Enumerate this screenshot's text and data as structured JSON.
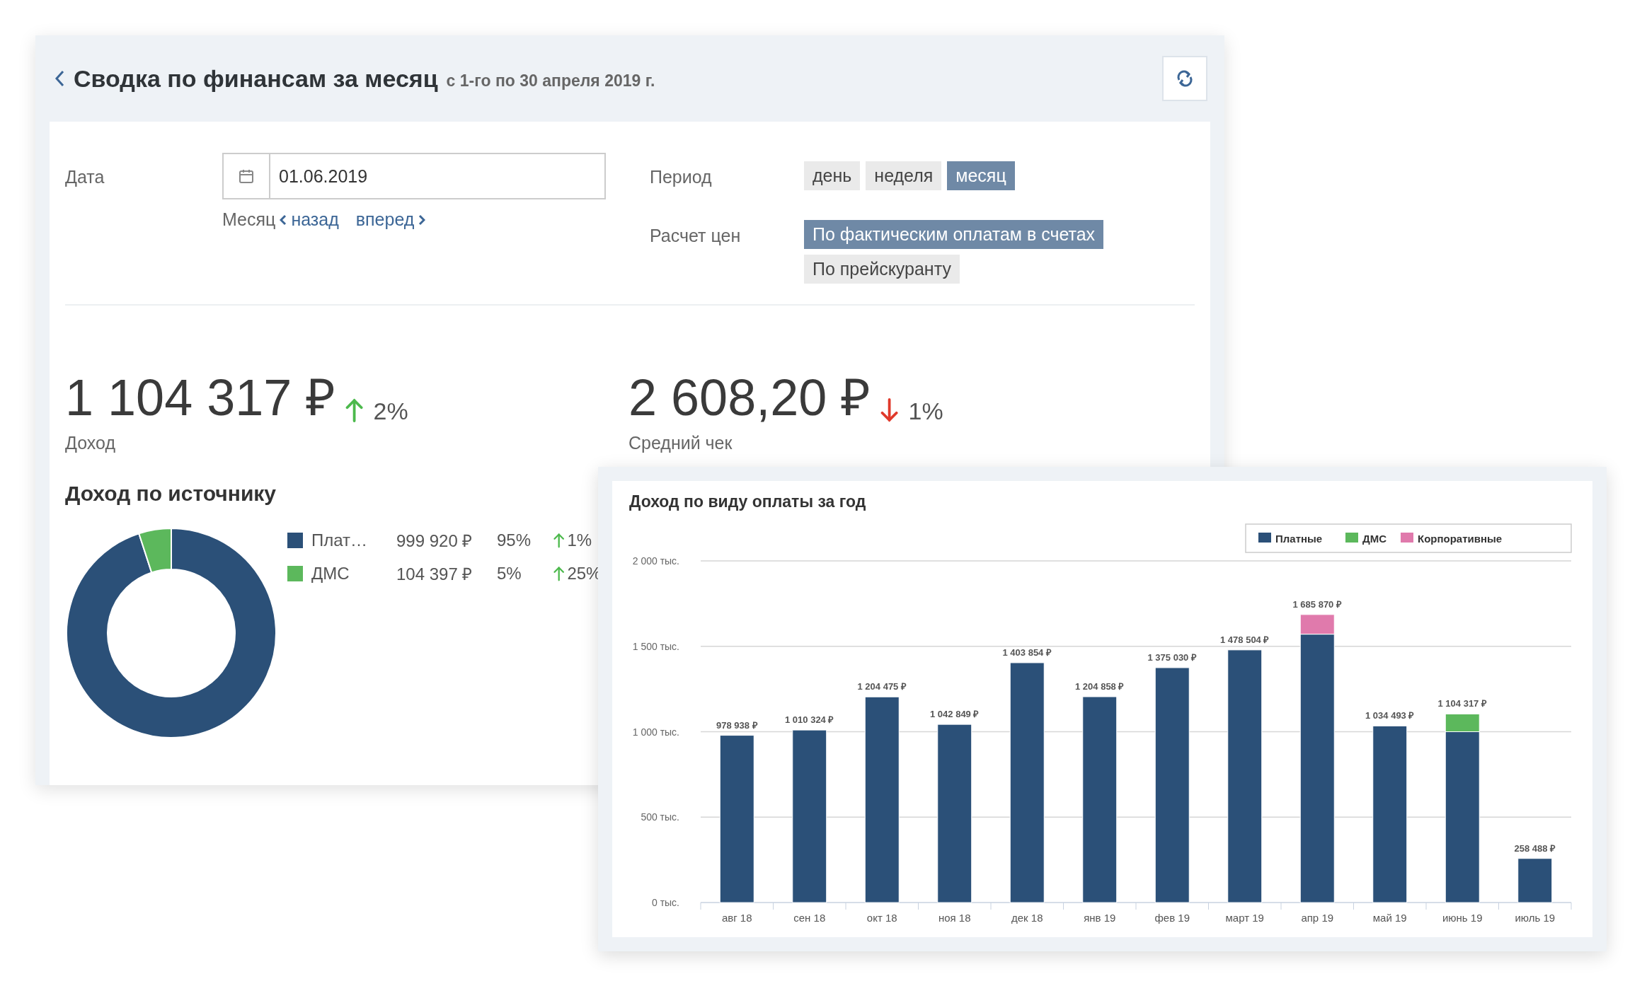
{
  "header": {
    "title": "Сводка по финансам за месяц",
    "subtitle": "с 1-го по 30 апреля 2019 г."
  },
  "date": {
    "label": "Дата",
    "value": "01.06.2019"
  },
  "month_nav": {
    "label": "Месяц",
    "back": "назад",
    "forward": "вперед"
  },
  "period": {
    "label": "Период",
    "options": [
      {
        "label": "день",
        "selected": false
      },
      {
        "label": "неделя",
        "selected": false
      },
      {
        "label": "месяц",
        "selected": true
      }
    ]
  },
  "pricing": {
    "label": "Расчет цен",
    "options": [
      {
        "label": "По фактическим оплатам в счетах",
        "selected": true
      },
      {
        "label": "По прейскуранту",
        "selected": false
      }
    ]
  },
  "metrics": [
    {
      "value": "1 104 317 ₽",
      "rising": true,
      "change": "2%",
      "label": "Доход"
    },
    {
      "value": "2 608,20 ₽",
      "rising": false,
      "change": "1%",
      "label": "Средний чек"
    }
  ],
  "source": {
    "title": "Доход по источнику",
    "legend": [
      {
        "color": "#2b5078",
        "amount": "999 920 ₽",
        "share": "95%",
        "rising": true,
        "change": "1%"
      },
      {
        "color": "#5cb85c",
        "amount": "104 397 ₽",
        "share": "5%",
        "rising": true,
        "change": "25%"
      }
    ],
    "chart_data": {
      "type": "donut",
      "categories": [
        "Плат…",
        "ДМС"
      ],
      "values": [
        95,
        5
      ]
    }
  },
  "yearly": {
    "chart_data": {
      "type": "bar",
      "title": "Доход по виду оплаты за год",
      "stacked": true,
      "categories": [
        "авг 18",
        "сен 18",
        "окт 18",
        "ноя 18",
        "дек 18",
        "янв 19",
        "фев 19",
        "март 19",
        "апр 19",
        "май 19",
        "июнь 19",
        "июль 19"
      ],
      "series": [
        {
          "name": "Платные",
          "color": "#2b5078",
          "values": [
            979,
            1010,
            1204,
            1043,
            1404,
            1205,
            1375,
            1479,
            1571,
            1034,
            1000,
            258
          ]
        },
        {
          "name": "ДМС",
          "color": "#5cb85c",
          "values": [
            0,
            0,
            0,
            0,
            0,
            0,
            0,
            0,
            0,
            0,
            104,
            0
          ]
        },
        {
          "name": "Корпоративные",
          "color": "#e07aac",
          "values": [
            0,
            0,
            0,
            0,
            0,
            0,
            0,
            0,
            115,
            0,
            0,
            0
          ]
        }
      ],
      "ylim": [
        0,
        2000
      ],
      "grid": true,
      "legend": "top-right",
      "yticks": [
        {
          "value": 0,
          "label": "0 тыс."
        },
        {
          "value": 500,
          "label": "500 тыс."
        },
        {
          "value": 1000,
          "label": "1 000 тыс."
        },
        {
          "value": 1500,
          "label": "1 500 тыс."
        },
        {
          "value": 2000,
          "label": "2 000 тыс."
        }
      ],
      "value_labels": [
        "978 938 ₽",
        "1 010 324 ₽",
        "1 204 475 ₽",
        "1 042 849 ₽",
        "1 403 854 ₽",
        "1 204 858 ₽",
        "1 375 030 ₽",
        "1 478 504 ₽",
        "1 685 870 ₽",
        "1 034 493 ₽",
        "1 104 317 ₽",
        "258 488 ₽"
      ]
    }
  }
}
